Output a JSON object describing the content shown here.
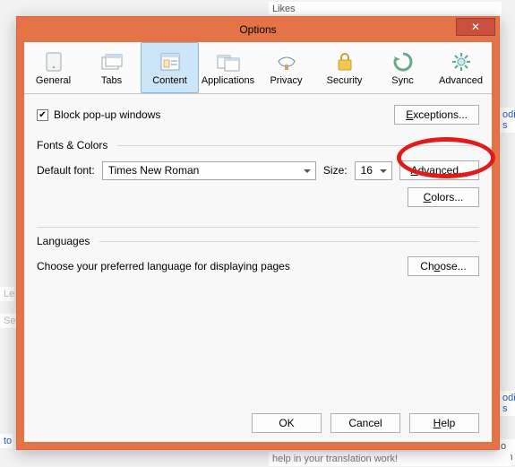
{
  "window": {
    "title": "Options"
  },
  "tabs": {
    "general": "General",
    "tabs": "Tabs",
    "content": "Content",
    "applications": "Applications",
    "privacy": "Privacy",
    "security": "Security",
    "sync": "Sync",
    "advanced": "Advanced"
  },
  "popup": {
    "block_label": "Block pop-up windows",
    "exceptions_btn": "Exceptions..."
  },
  "fonts": {
    "group_label": "Fonts & Colors",
    "default_font_label": "Default font:",
    "default_font_value": "Times New Roman",
    "size_label": "Size:",
    "size_value": "16",
    "advanced_btn": "Advanced...",
    "colors_btn": "Colors..."
  },
  "languages": {
    "group_label": "Languages",
    "desc": "Choose your preferred language for displaying pages",
    "choose_btn": "Choose..."
  },
  "footer": {
    "ok": "OK",
    "cancel": "Cancel",
    "help": "Help"
  },
  "background": {
    "likes": "Likes",
    "le": "Le",
    "sele": "Sele",
    "odia1": "odia s",
    "odia2": "odia s",
    "to": "to",
    "okh": "o Kh",
    "help_line": "help in your translation work!"
  }
}
